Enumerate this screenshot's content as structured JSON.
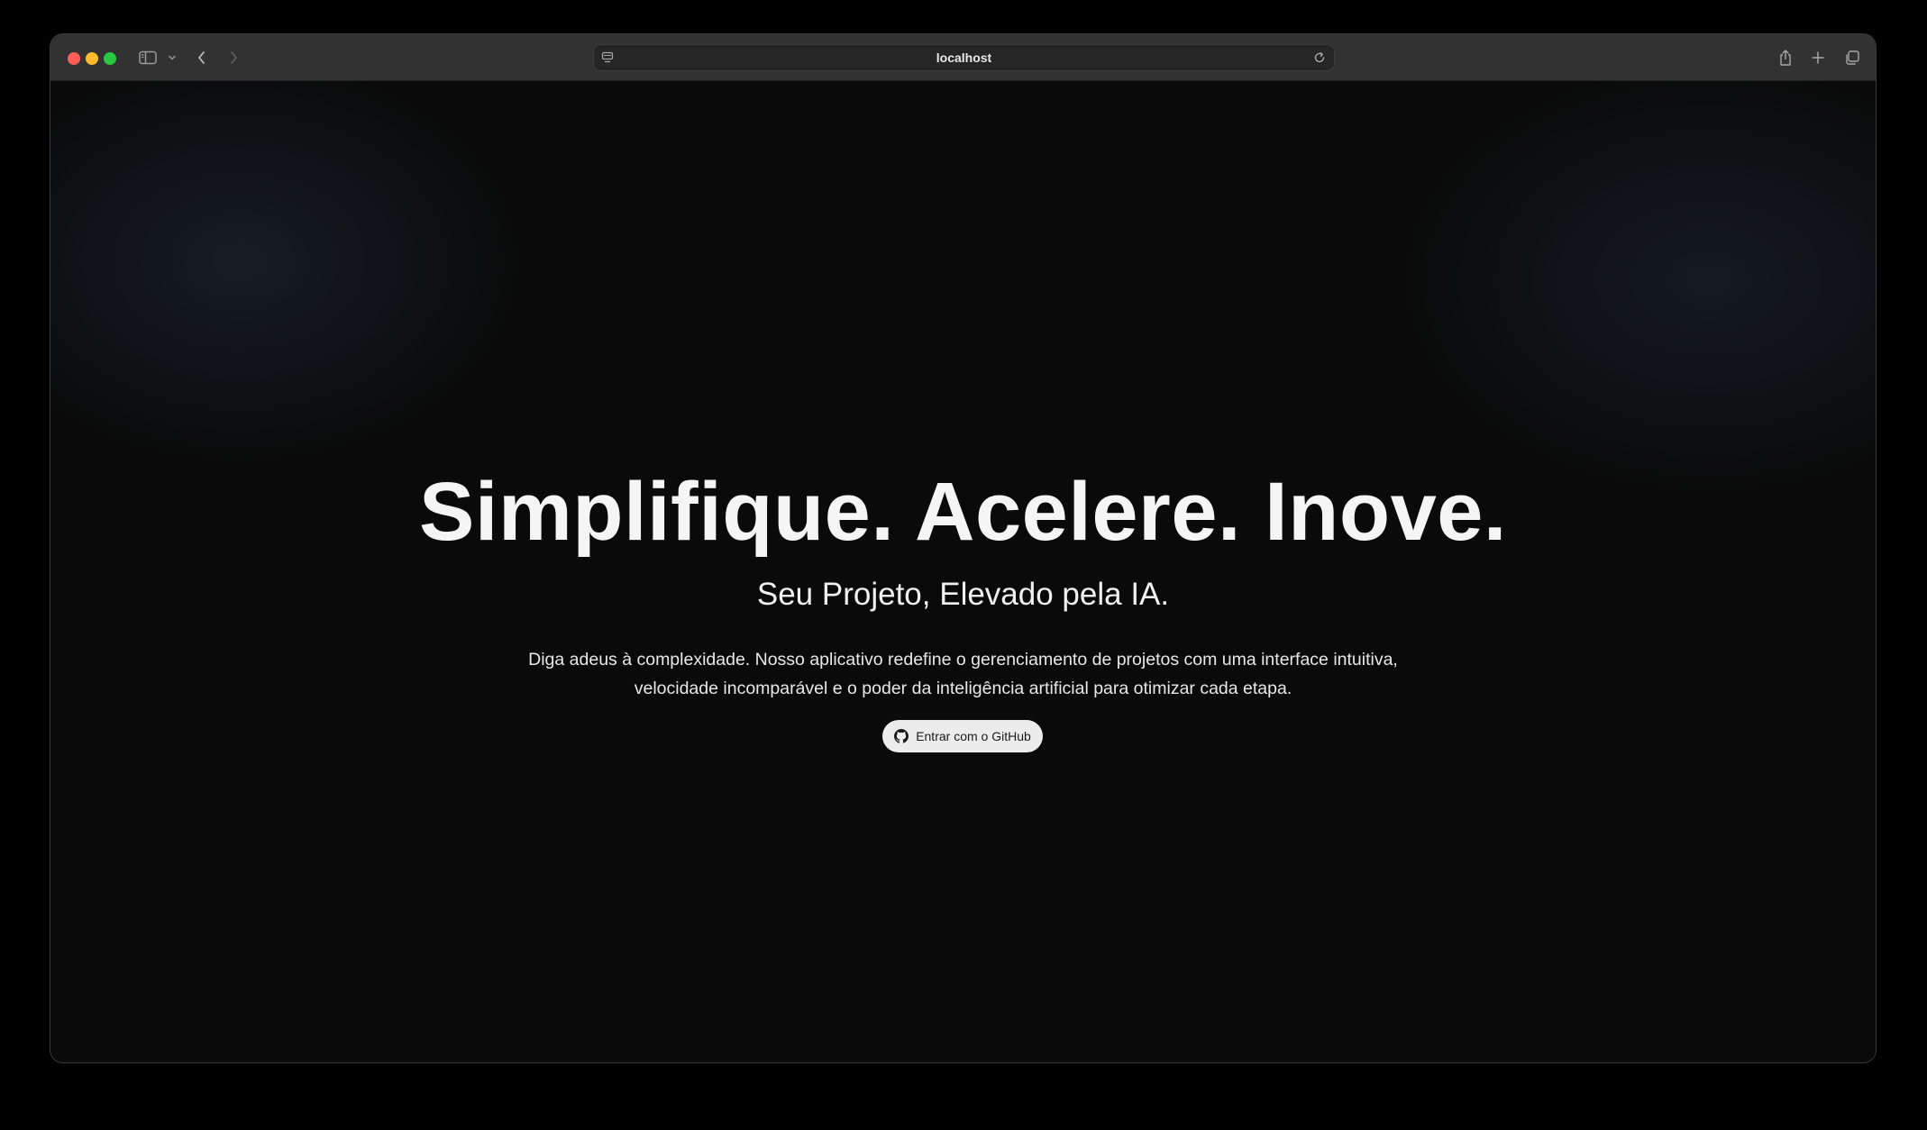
{
  "browser": {
    "url": "localhost"
  },
  "hero": {
    "headline": "Simplifique. Acelere. Inove.",
    "subheadline": "Seu Projeto, Elevado pela IA.",
    "description_line1": "Diga adeus à complexidade. Nosso aplicativo redefine o gerenciamento de projetos com uma interface intuitiva,",
    "description_line2": "velocidade incomparável e o poder da inteligência artificial para otimizar cada etapa.",
    "button_label": "Entrar com o GitHub"
  },
  "icons": {
    "sidebar": "sidebar-icon",
    "back": "chevron-left-icon",
    "forward": "chevron-right-icon",
    "share": "share-icon",
    "new_tab": "plus-icon",
    "tabs": "tabs-overview-icon",
    "reload": "reload-icon",
    "site_settings": "page-settings-icon",
    "github": "github-icon"
  },
  "colors": {
    "page_background": "#0a0a0a",
    "button_background": "#ececec",
    "toolbar": "#323232"
  }
}
